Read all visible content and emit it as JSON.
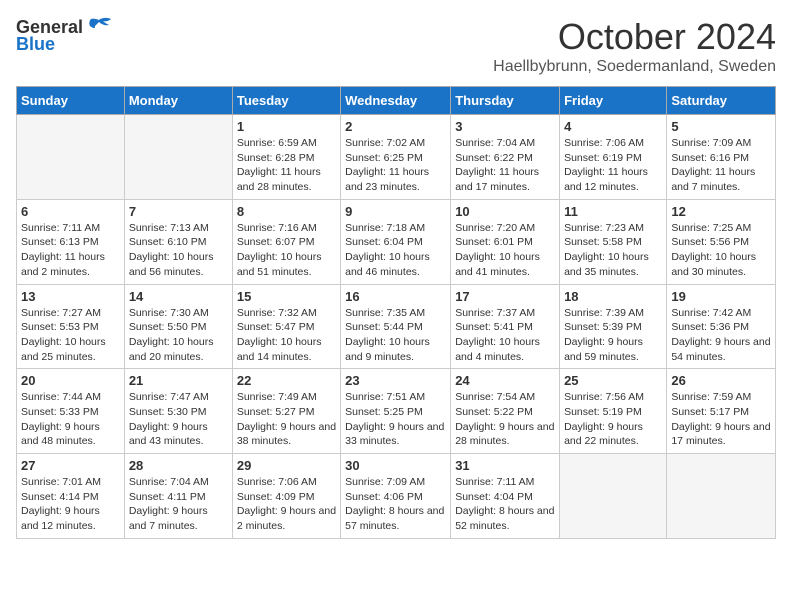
{
  "logo": {
    "general": "General",
    "blue": "Blue"
  },
  "title": "October 2024",
  "location": "Haellbybrunn, Soedermanland, Sweden",
  "headers": [
    "Sunday",
    "Monday",
    "Tuesday",
    "Wednesday",
    "Thursday",
    "Friday",
    "Saturday"
  ],
  "weeks": [
    [
      {
        "day": "",
        "sunrise": "",
        "sunset": "",
        "daylight": ""
      },
      {
        "day": "",
        "sunrise": "",
        "sunset": "",
        "daylight": ""
      },
      {
        "day": "1",
        "sunrise": "Sunrise: 6:59 AM",
        "sunset": "Sunset: 6:28 PM",
        "daylight": "Daylight: 11 hours and 28 minutes."
      },
      {
        "day": "2",
        "sunrise": "Sunrise: 7:02 AM",
        "sunset": "Sunset: 6:25 PM",
        "daylight": "Daylight: 11 hours and 23 minutes."
      },
      {
        "day": "3",
        "sunrise": "Sunrise: 7:04 AM",
        "sunset": "Sunset: 6:22 PM",
        "daylight": "Daylight: 11 hours and 17 minutes."
      },
      {
        "day": "4",
        "sunrise": "Sunrise: 7:06 AM",
        "sunset": "Sunset: 6:19 PM",
        "daylight": "Daylight: 11 hours and 12 minutes."
      },
      {
        "day": "5",
        "sunrise": "Sunrise: 7:09 AM",
        "sunset": "Sunset: 6:16 PM",
        "daylight": "Daylight: 11 hours and 7 minutes."
      }
    ],
    [
      {
        "day": "6",
        "sunrise": "Sunrise: 7:11 AM",
        "sunset": "Sunset: 6:13 PM",
        "daylight": "Daylight: 11 hours and 2 minutes."
      },
      {
        "day": "7",
        "sunrise": "Sunrise: 7:13 AM",
        "sunset": "Sunset: 6:10 PM",
        "daylight": "Daylight: 10 hours and 56 minutes."
      },
      {
        "day": "8",
        "sunrise": "Sunrise: 7:16 AM",
        "sunset": "Sunset: 6:07 PM",
        "daylight": "Daylight: 10 hours and 51 minutes."
      },
      {
        "day": "9",
        "sunrise": "Sunrise: 7:18 AM",
        "sunset": "Sunset: 6:04 PM",
        "daylight": "Daylight: 10 hours and 46 minutes."
      },
      {
        "day": "10",
        "sunrise": "Sunrise: 7:20 AM",
        "sunset": "Sunset: 6:01 PM",
        "daylight": "Daylight: 10 hours and 41 minutes."
      },
      {
        "day": "11",
        "sunrise": "Sunrise: 7:23 AM",
        "sunset": "Sunset: 5:58 PM",
        "daylight": "Daylight: 10 hours and 35 minutes."
      },
      {
        "day": "12",
        "sunrise": "Sunrise: 7:25 AM",
        "sunset": "Sunset: 5:56 PM",
        "daylight": "Daylight: 10 hours and 30 minutes."
      }
    ],
    [
      {
        "day": "13",
        "sunrise": "Sunrise: 7:27 AM",
        "sunset": "Sunset: 5:53 PM",
        "daylight": "Daylight: 10 hours and 25 minutes."
      },
      {
        "day": "14",
        "sunrise": "Sunrise: 7:30 AM",
        "sunset": "Sunset: 5:50 PM",
        "daylight": "Daylight: 10 hours and 20 minutes."
      },
      {
        "day": "15",
        "sunrise": "Sunrise: 7:32 AM",
        "sunset": "Sunset: 5:47 PM",
        "daylight": "Daylight: 10 hours and 14 minutes."
      },
      {
        "day": "16",
        "sunrise": "Sunrise: 7:35 AM",
        "sunset": "Sunset: 5:44 PM",
        "daylight": "Daylight: 10 hours and 9 minutes."
      },
      {
        "day": "17",
        "sunrise": "Sunrise: 7:37 AM",
        "sunset": "Sunset: 5:41 PM",
        "daylight": "Daylight: 10 hours and 4 minutes."
      },
      {
        "day": "18",
        "sunrise": "Sunrise: 7:39 AM",
        "sunset": "Sunset: 5:39 PM",
        "daylight": "Daylight: 9 hours and 59 minutes."
      },
      {
        "day": "19",
        "sunrise": "Sunrise: 7:42 AM",
        "sunset": "Sunset: 5:36 PM",
        "daylight": "Daylight: 9 hours and 54 minutes."
      }
    ],
    [
      {
        "day": "20",
        "sunrise": "Sunrise: 7:44 AM",
        "sunset": "Sunset: 5:33 PM",
        "daylight": "Daylight: 9 hours and 48 minutes."
      },
      {
        "day": "21",
        "sunrise": "Sunrise: 7:47 AM",
        "sunset": "Sunset: 5:30 PM",
        "daylight": "Daylight: 9 hours and 43 minutes."
      },
      {
        "day": "22",
        "sunrise": "Sunrise: 7:49 AM",
        "sunset": "Sunset: 5:27 PM",
        "daylight": "Daylight: 9 hours and 38 minutes."
      },
      {
        "day": "23",
        "sunrise": "Sunrise: 7:51 AM",
        "sunset": "Sunset: 5:25 PM",
        "daylight": "Daylight: 9 hours and 33 minutes."
      },
      {
        "day": "24",
        "sunrise": "Sunrise: 7:54 AM",
        "sunset": "Sunset: 5:22 PM",
        "daylight": "Daylight: 9 hours and 28 minutes."
      },
      {
        "day": "25",
        "sunrise": "Sunrise: 7:56 AM",
        "sunset": "Sunset: 5:19 PM",
        "daylight": "Daylight: 9 hours and 22 minutes."
      },
      {
        "day": "26",
        "sunrise": "Sunrise: 7:59 AM",
        "sunset": "Sunset: 5:17 PM",
        "daylight": "Daylight: 9 hours and 17 minutes."
      }
    ],
    [
      {
        "day": "27",
        "sunrise": "Sunrise: 7:01 AM",
        "sunset": "Sunset: 4:14 PM",
        "daylight": "Daylight: 9 hours and 12 minutes."
      },
      {
        "day": "28",
        "sunrise": "Sunrise: 7:04 AM",
        "sunset": "Sunset: 4:11 PM",
        "daylight": "Daylight: 9 hours and 7 minutes."
      },
      {
        "day": "29",
        "sunrise": "Sunrise: 7:06 AM",
        "sunset": "Sunset: 4:09 PM",
        "daylight": "Daylight: 9 hours and 2 minutes."
      },
      {
        "day": "30",
        "sunrise": "Sunrise: 7:09 AM",
        "sunset": "Sunset: 4:06 PM",
        "daylight": "Daylight: 8 hours and 57 minutes."
      },
      {
        "day": "31",
        "sunrise": "Sunrise: 7:11 AM",
        "sunset": "Sunset: 4:04 PM",
        "daylight": "Daylight: 8 hours and 52 minutes."
      },
      {
        "day": "",
        "sunrise": "",
        "sunset": "",
        "daylight": ""
      },
      {
        "day": "",
        "sunrise": "",
        "sunset": "",
        "daylight": ""
      }
    ]
  ]
}
